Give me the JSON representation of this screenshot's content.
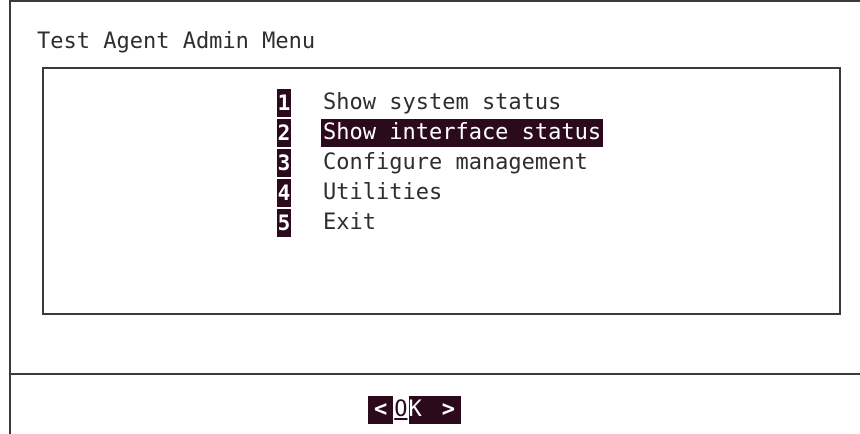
{
  "dialog": {
    "title": "Test Agent Admin Menu"
  },
  "menu": {
    "items": [
      {
        "key": "1",
        "label": "Show system status",
        "selected": false
      },
      {
        "key": "2",
        "label": "Show interface status",
        "selected": true
      },
      {
        "key": "3",
        "label": "Configure management",
        "selected": false
      },
      {
        "key": "4",
        "label": "Utilities",
        "selected": false
      },
      {
        "key": "5",
        "label": "Exit",
        "selected": false
      }
    ]
  },
  "buttons": {
    "ok": {
      "left_bracket": "<",
      "hotkey": "O",
      "rest": "K",
      "right_bracket": ">"
    }
  },
  "colors": {
    "highlight_bg": "#2c0a1e",
    "highlight_fg": "#ffffff",
    "text": "#2e2e2e",
    "border": "#3a3a3a",
    "background": "#ffffff"
  }
}
